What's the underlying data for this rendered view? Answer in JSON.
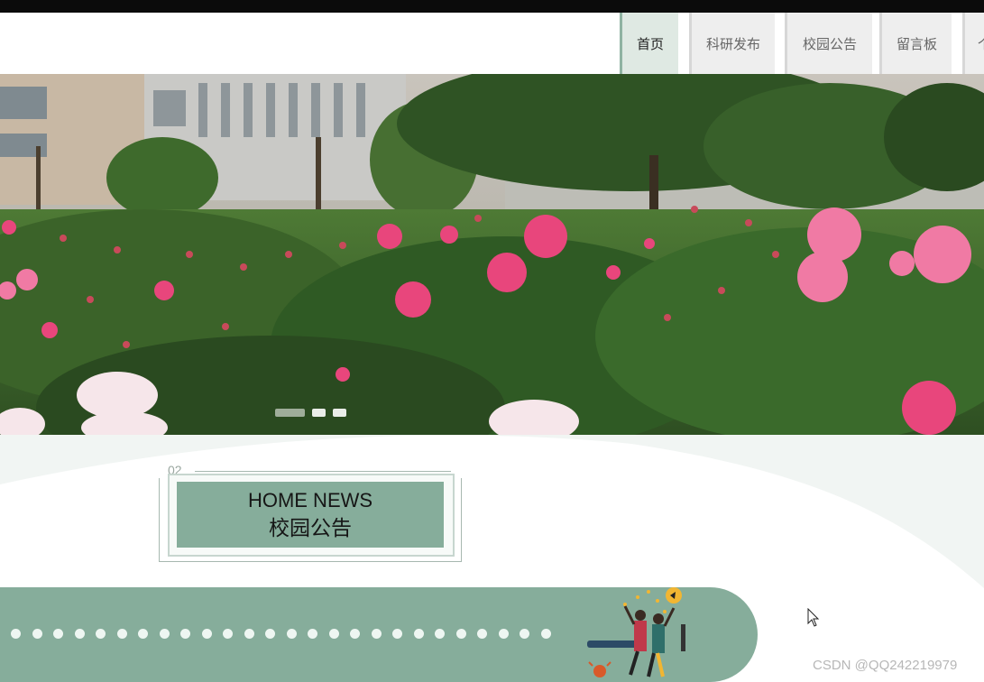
{
  "nav": {
    "items": [
      {
        "label": "首页",
        "active": true
      },
      {
        "label": "科研发布",
        "active": false
      },
      {
        "label": "校园公告",
        "active": false
      },
      {
        "label": "留言板",
        "active": false
      },
      {
        "label": "个",
        "active": false
      }
    ]
  },
  "banner": {
    "image": "peony-garden-photo",
    "slides": 3,
    "active_slide": 1
  },
  "section": {
    "number": "02",
    "title_en": "HOME NEWS",
    "title_cn": "校园公告"
  },
  "watermark": "CSDN @QQ242219979",
  "colors": {
    "accent": "#86ad9b",
    "nav_bg": "#eeeeee",
    "nav_active_bg": "#dfe9e3",
    "topbar": "#0b0b0b"
  },
  "icons": {
    "cursor": "mouse-pointer-icon",
    "illustration": "people-celebrating-illustration"
  }
}
